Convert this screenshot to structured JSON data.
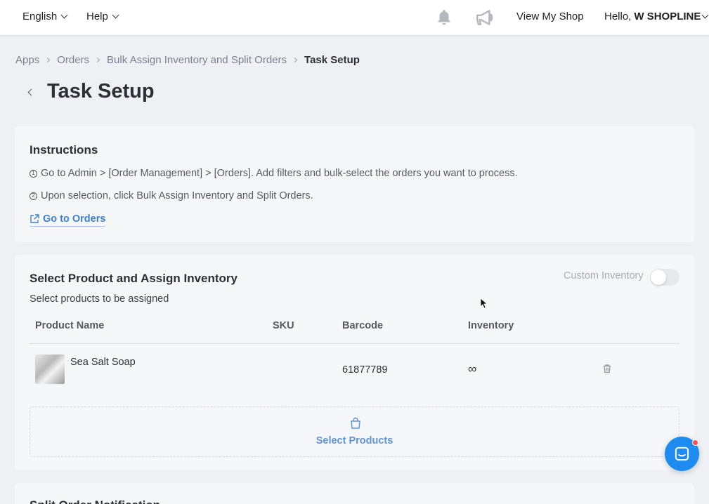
{
  "topbar": {
    "language": "English",
    "help": "Help",
    "view_shop": "View My Shop",
    "hello_prefix": "Hello,",
    "shop_name": "W SHOPLINE"
  },
  "breadcrumb": [
    "Apps",
    "Orders",
    "Bulk Assign Inventory and Split Orders",
    "Task Setup"
  ],
  "page_title": "Task Setup",
  "instructions": {
    "title": "Instructions",
    "steps": [
      {
        "num": "1",
        "text": "Go to Admin > [Order Management] > [Orders]. Add filters and bulk-select the orders you want to process."
      },
      {
        "num": "2",
        "text": "Upon selection, click Bulk Assign Inventory and Split Orders."
      }
    ],
    "link": "Go to Orders"
  },
  "assign": {
    "title": "Select Product and Assign Inventory",
    "subtitle": "Select products to be assigned",
    "custom_inventory_label": "Custom Inventory",
    "custom_inventory_on": false,
    "columns": [
      "Product Name",
      "SKU",
      "Barcode",
      "Inventory"
    ],
    "rows": [
      {
        "name": "Sea Salt Soap",
        "sku": "",
        "barcode": "61877789",
        "inventory": "∞"
      }
    ],
    "select_products": "Select Products"
  },
  "split": {
    "title": "Split Order Notification"
  },
  "colors": {
    "link": "#3d7fd1",
    "chat": "#1d8bf0"
  }
}
